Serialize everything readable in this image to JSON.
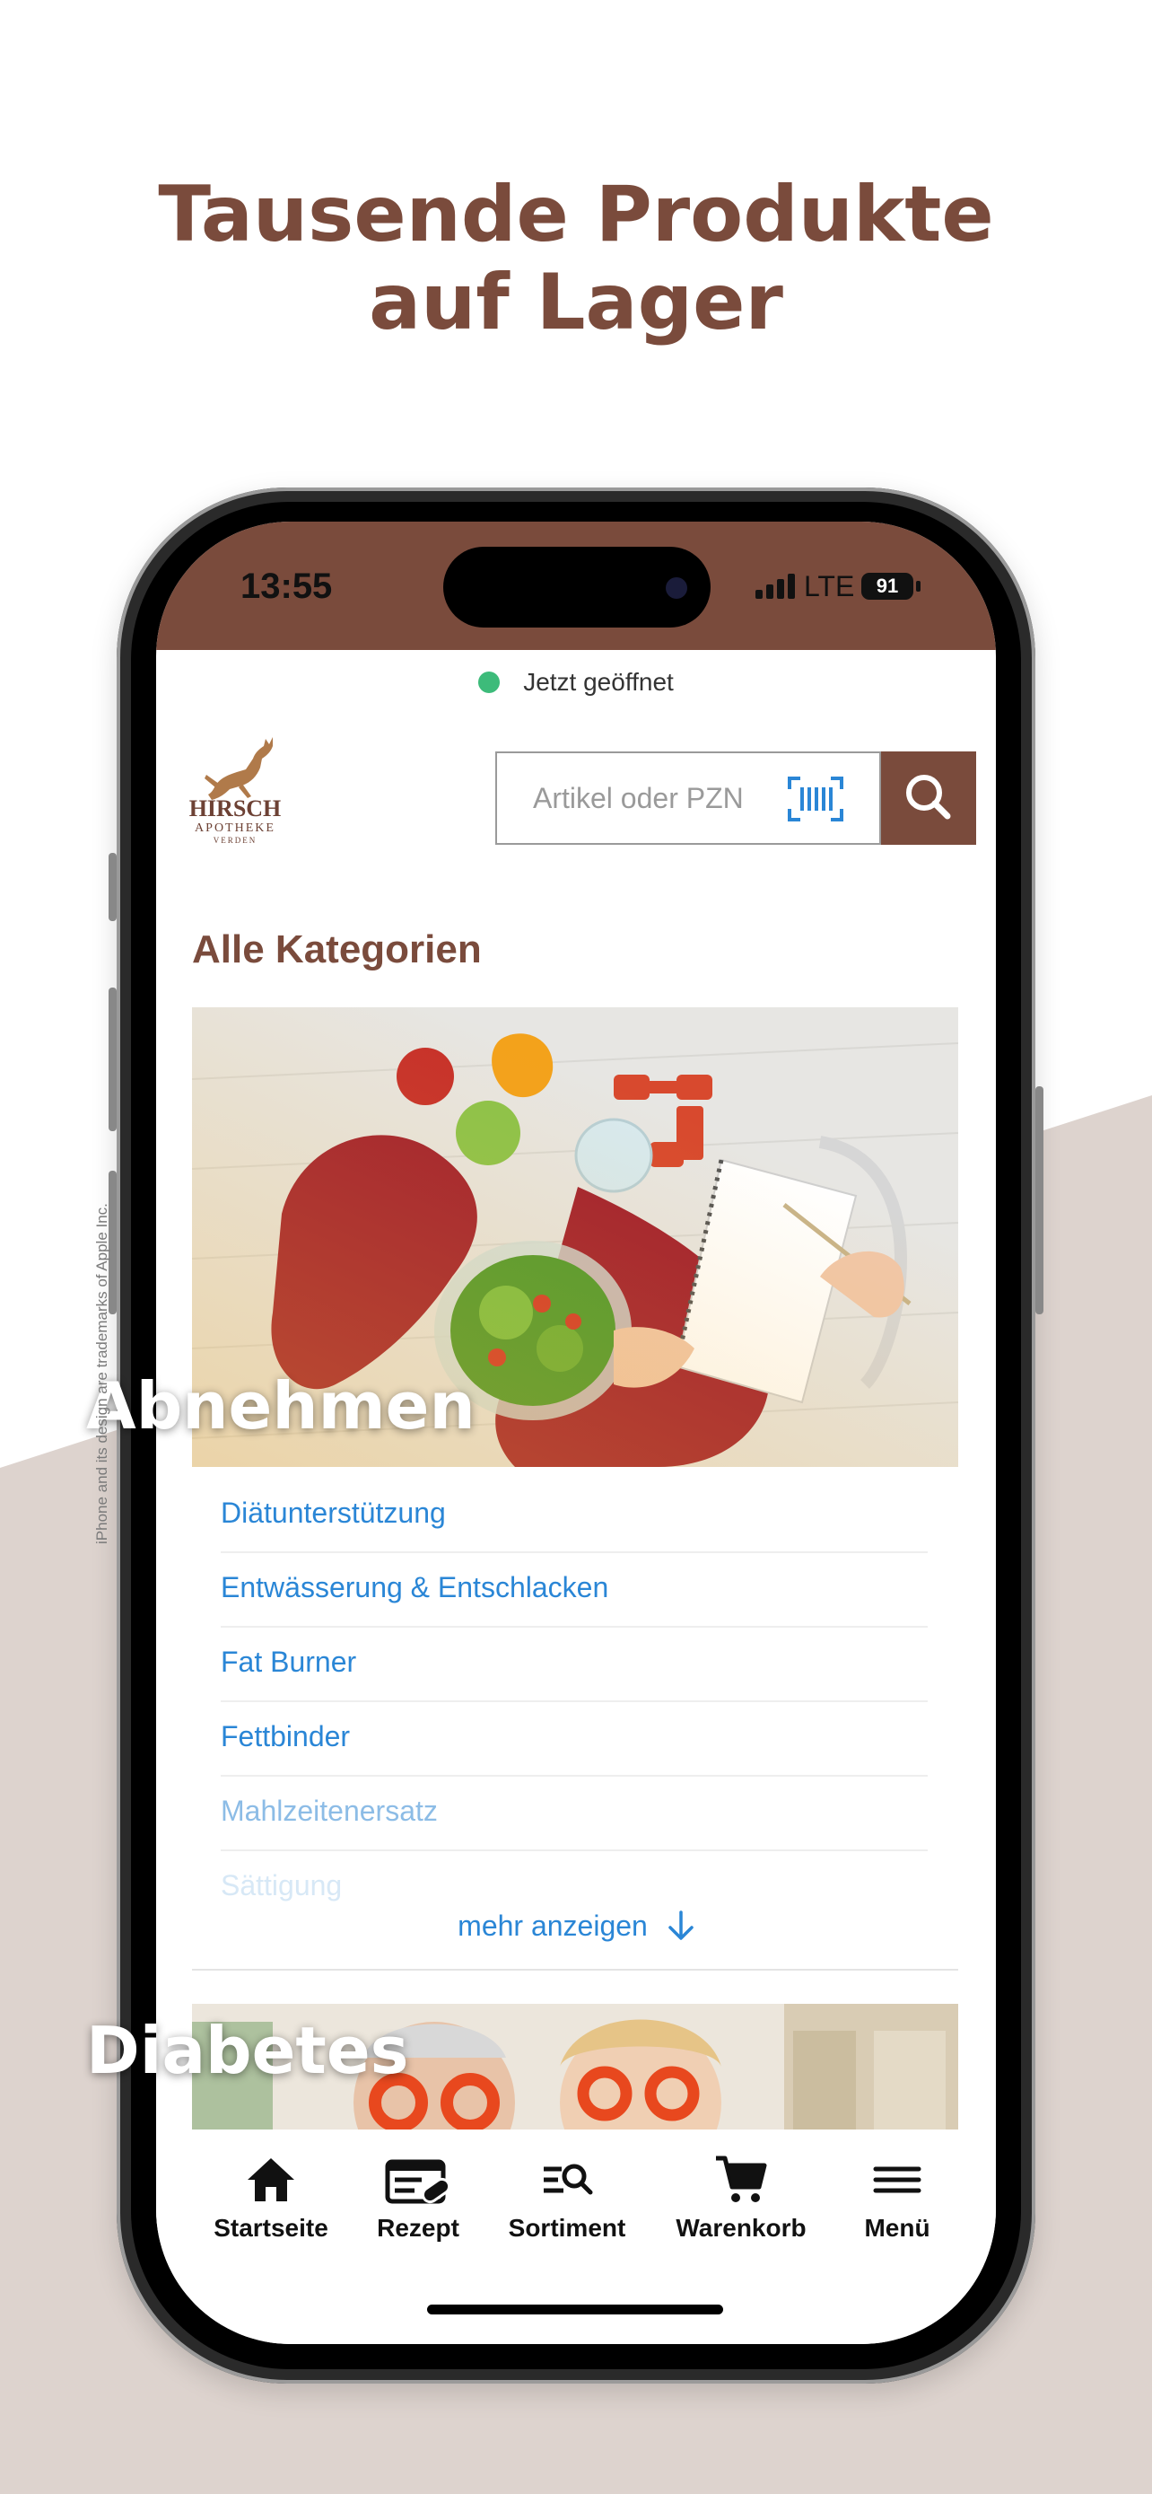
{
  "headline": {
    "line1": "Tausende Produkte",
    "line2": "auf Lager"
  },
  "status_bar": {
    "time": "13:55",
    "network": "LTE",
    "battery": "91"
  },
  "store_status": "Jetzt geöffnet",
  "logo": {
    "name": "HIRSCH",
    "subtitle": "APOTHEKE",
    "city": "VERDEN"
  },
  "search": {
    "placeholder": "Artikel oder PZN"
  },
  "page_title": "Alle Kategorien",
  "categories": [
    {
      "label": "Abnehmen",
      "subcategories": [
        "Diätunterstützung",
        "Entwässerung & Entschlacken",
        "Fat Burner",
        "Fettbinder",
        "Mahlzeitenersatz",
        "Sättigung"
      ]
    },
    {
      "label": "Diabetes"
    }
  ],
  "more_label": "mehr anzeigen",
  "tabbar": {
    "items": [
      {
        "label": "Startseite",
        "icon": "home-icon"
      },
      {
        "label": "Rezept",
        "icon": "prescription-icon"
      },
      {
        "label": "Sortiment",
        "icon": "catalog-search-icon"
      },
      {
        "label": "Warenkorb",
        "icon": "cart-icon"
      },
      {
        "label": "Menü",
        "icon": "menu-icon"
      }
    ]
  },
  "trademark": "iPhone and its design are trademarks of Apple Inc.",
  "colors": {
    "brand_brown": "#7a4b3c",
    "link_blue": "#2a86d6",
    "open_green": "#3dbb7a",
    "background_taupe": "#ddd3ce"
  }
}
